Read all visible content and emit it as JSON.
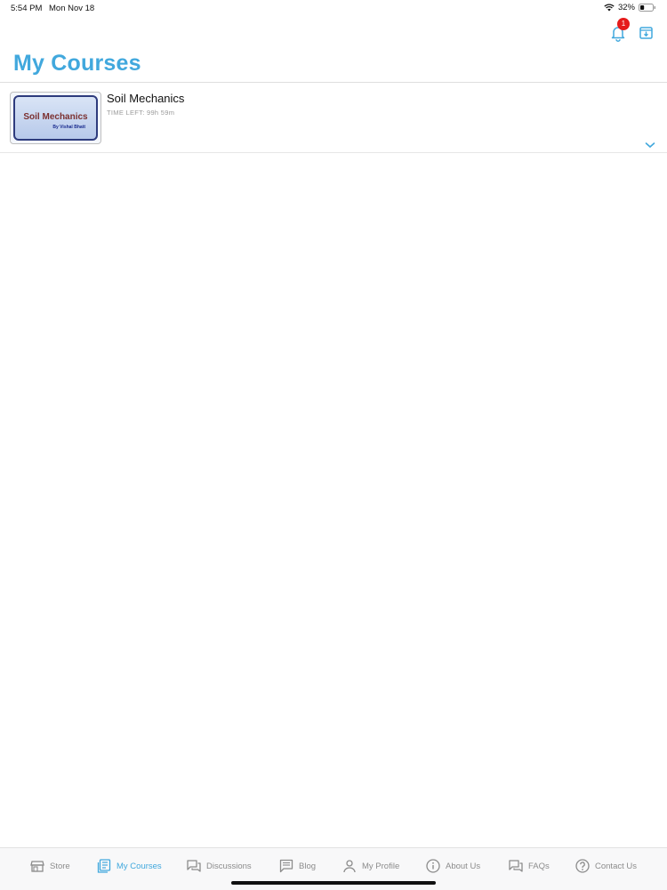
{
  "status_bar": {
    "time": "5:54 PM",
    "date": "Mon Nov 18",
    "battery": "32%",
    "battery_level": 0.32
  },
  "header": {
    "title": "My Courses",
    "notification_count": "1",
    "icons": [
      "bell-icon",
      "download-icon"
    ]
  },
  "colors": {
    "accent": "#41a8dd",
    "badge": "#e51b1b",
    "inactive": "#8c8c8c"
  },
  "courses": [
    {
      "thumbnail_title": "Soil Mechanics",
      "thumbnail_author": "By Vishal Bhatt",
      "title": "Soil Mechanics",
      "time_left": "TIME LEFT: 99h 59m"
    }
  ],
  "tabs": [
    {
      "label": "Store",
      "icon": "store-icon",
      "active": false
    },
    {
      "label": "My Courses",
      "icon": "courses-icon",
      "active": true
    },
    {
      "label": "Discussions",
      "icon": "discussions-icon",
      "active": false
    },
    {
      "label": "Blog",
      "icon": "blog-icon",
      "active": false
    },
    {
      "label": "My Profile",
      "icon": "profile-icon",
      "active": false
    },
    {
      "label": "About Us",
      "icon": "info-icon",
      "active": false
    },
    {
      "label": "FAQs",
      "icon": "faqs-icon",
      "active": false
    },
    {
      "label": "Contact Us",
      "icon": "help-icon",
      "active": false
    }
  ]
}
